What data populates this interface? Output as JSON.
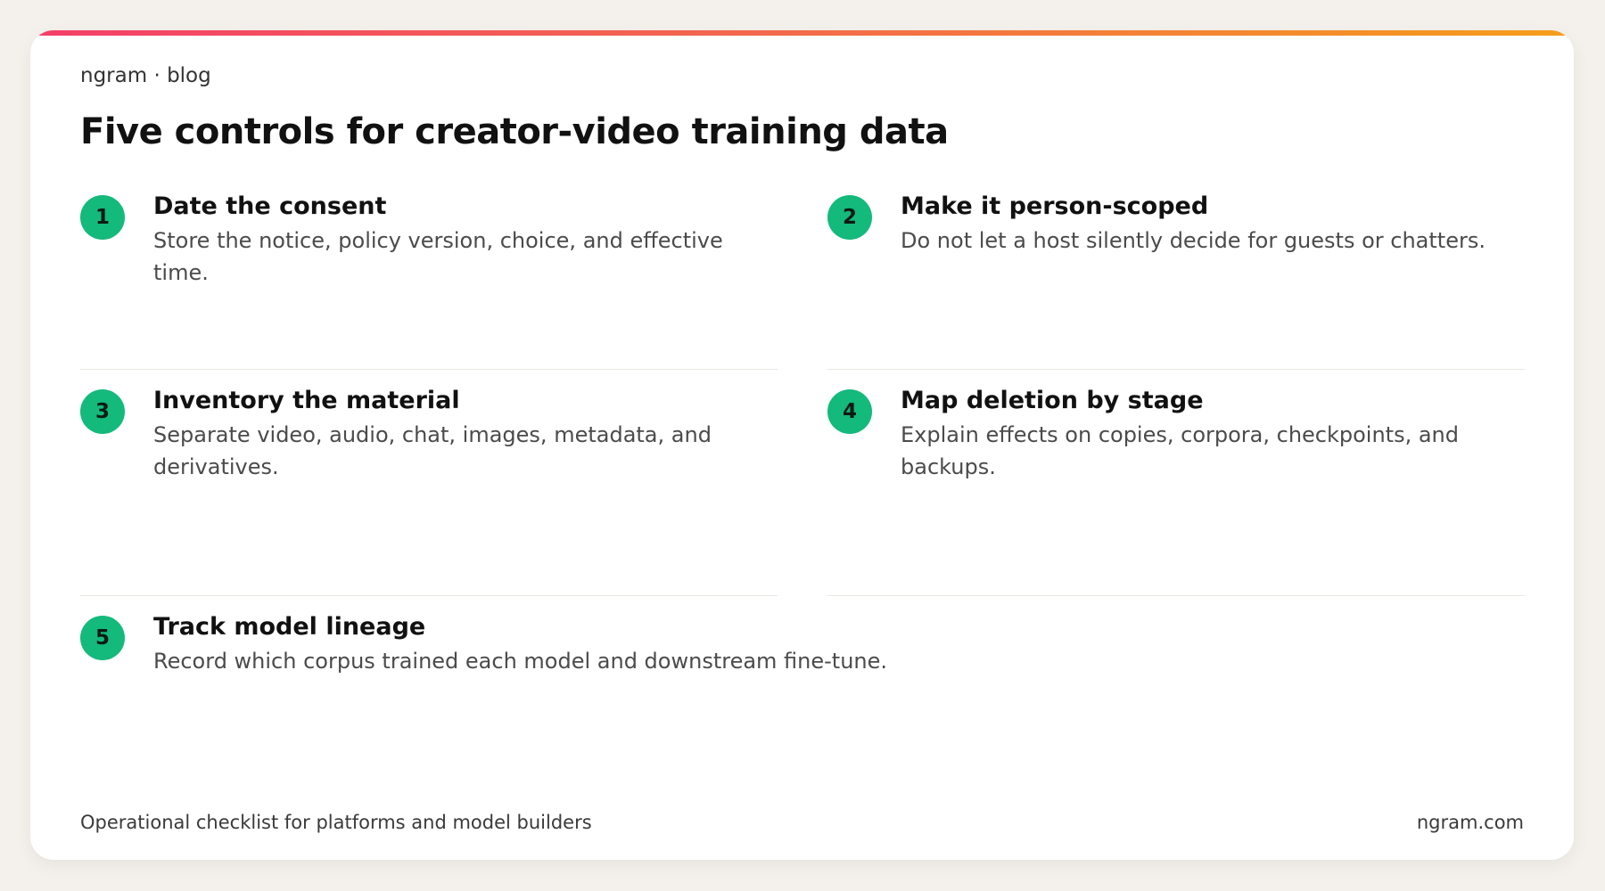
{
  "header": {
    "brand": "ngram · blog",
    "title": "Five controls for creator-video training data"
  },
  "items": [
    {
      "number": "1",
      "title": "Date the consent",
      "description": "Store the notice, policy version, choice, and effective time."
    },
    {
      "number": "2",
      "title": "Make it person-scoped",
      "description": "Do not let a host silently decide for guests or chatters."
    },
    {
      "number": "3",
      "title": "Inventory the material",
      "description": "Separate video, audio, chat, images, metadata, and derivatives."
    },
    {
      "number": "4",
      "title": "Map deletion by stage",
      "description": "Explain effects on copies, corpora, checkpoints, and backups."
    },
    {
      "number": "5",
      "title": "Track model lineage",
      "description": "Record which corpus trained each model and downstream fine-tune."
    }
  ],
  "footer": {
    "left": "Operational checklist for platforms and model builders",
    "right": "ngram.com"
  },
  "colors": {
    "accent_start": "#f43f6a",
    "accent_end": "#f59e1b",
    "badge": "#14b97c"
  }
}
